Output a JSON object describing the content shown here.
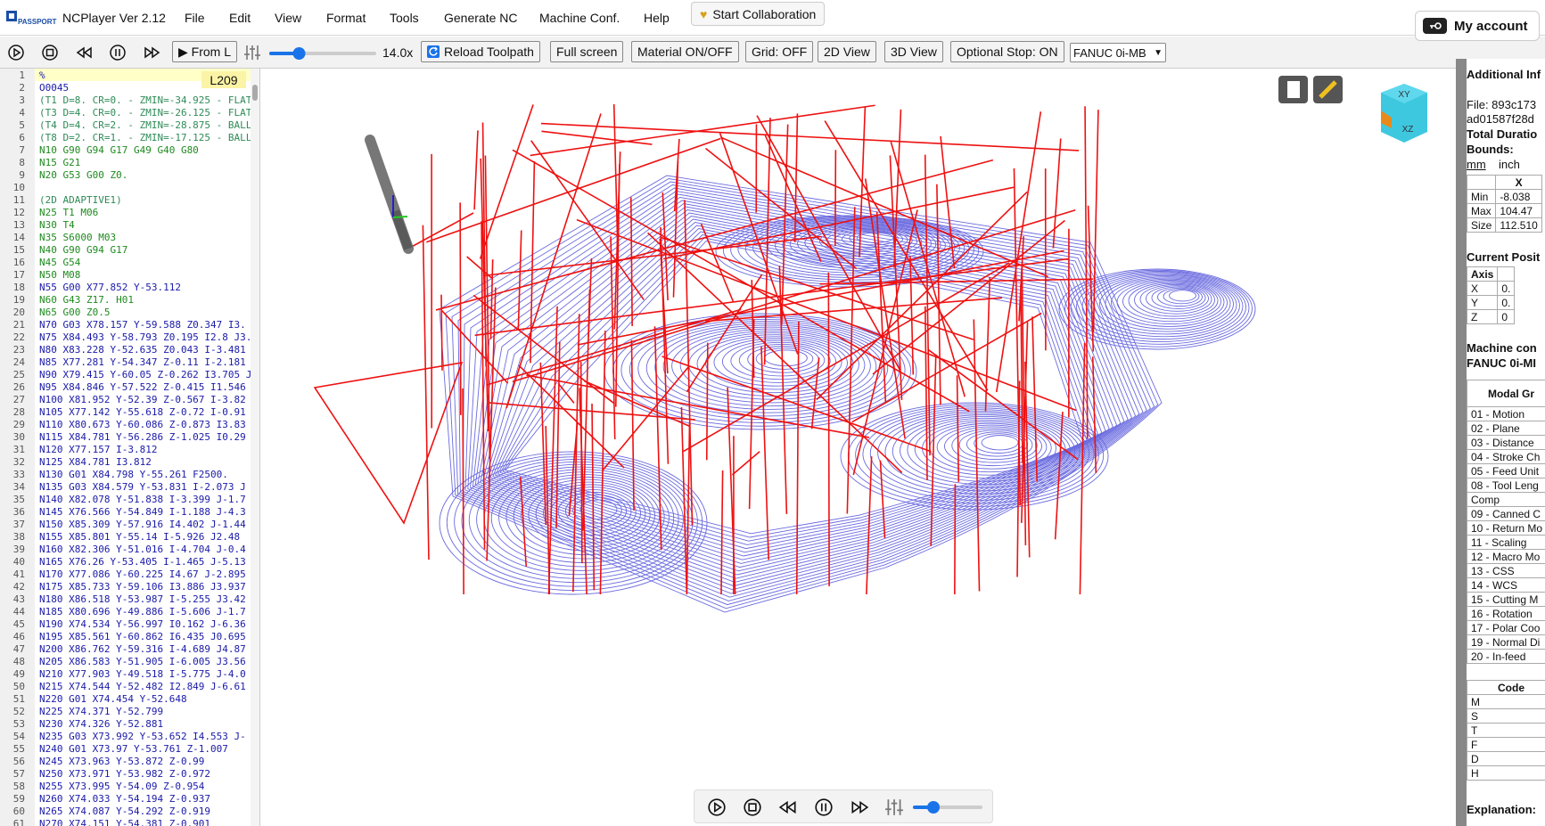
{
  "app": {
    "title": "NCPlayer Ver 2.12",
    "logo_text": "PASSPORT"
  },
  "menu": [
    "File",
    "Edit",
    "View",
    "Format",
    "Tools",
    "Generate NC",
    "Machine Conf.",
    "Help"
  ],
  "collaboration_button": "Start Collaboration",
  "account_button": "My account",
  "toolbar": {
    "from_line": "▶ From L",
    "speed_value": 0.25,
    "speed_label": "14.0x",
    "reload": "Reload Toolpath",
    "full_screen": "Full screen",
    "material": "Material ON/OFF",
    "grid": "Grid: OFF",
    "view2d": "2D View",
    "view3d": "3D View",
    "optional_stop": "Optional Stop: ON",
    "control": "FANUC 0i-MB"
  },
  "editor": {
    "line_badge": "L209",
    "lines": [
      "%",
      "O0045",
      "(T1 D=8. CR=0. - ZMIN=-34.925 - FLAT",
      "(T3 D=4. CR=0. - ZMIN=-26.125 - FLAT",
      "(T4 D=4. CR=2. - ZMIN=-28.875 - BALL",
      "(T8 D=2. CR=1. - ZMIN=-17.125 - BALL",
      "N10 G90 G94 G17 G49 G40 G80",
      "N15 G21",
      "N20 G53 G00 Z0.",
      "",
      "(2D ADAPTIVE1)",
      "N25 T1 M06",
      "N30 T4",
      "N35 S6000 M03",
      "N40 G90 G94 G17",
      "N45 G54",
      "N50 M08",
      "N55 G00 X77.852 Y-53.112",
      "N60 G43 Z17. H01",
      "N65 G00 Z0.5",
      "N70 G03 X78.157 Y-59.588 Z0.347 I3.",
      "N75 X84.493 Y-58.793 Z0.195 I2.8 J3.",
      "N80 X83.228 Y-52.635 Z0.043 I-3.481",
      "N85 X77.281 Y-54.347 Z-0.11 I-2.181",
      "N90 X79.415 Y-60.05 Z-0.262 I3.705 J",
      "N95 X84.846 Y-57.522 Z-0.415 I1.546",
      "N100 X81.952 Y-52.39 Z-0.567 I-3.82",
      "N105 X77.142 Y-55.618 Z-0.72 I-0.91",
      "N110 X80.673 Y-60.086 Z-0.873 I3.83",
      "N115 X84.781 Y-56.286 Z-1.025 I0.29",
      "N120 X77.157 I-3.812",
      "N125 X84.781 I3.812",
      "N130 G01 X84.798 Y-55.261 F2500.",
      "N135 G03 X84.579 Y-53.831 I-2.073 J",
      "N140 X82.078 Y-51.838 I-3.399 J-1.7",
      "N145 X76.566 Y-54.849 I-1.188 J-4.3",
      "N150 X85.309 Y-57.916 I4.402 J-1.44",
      "N155 X85.801 Y-55.14 I-5.926 J2.48",
      "N160 X82.306 Y-51.016 I-4.704 J-0.4",
      "N165 X76.26 Y-53.405 I-1.465 J-5.13",
      "N170 X77.086 Y-60.225 I4.67 J-2.895",
      "N175 X85.733 Y-59.106 I3.886 J3.937",
      "N180 X86.518 Y-53.987 I-5.255 J3.42",
      "N185 X80.696 Y-49.886 I-5.606 J-1.7",
      "N190 X74.534 Y-56.997 I0.162 J-6.36",
      "N195 X85.561 Y-60.862 I6.435 J0.695",
      "N200 X86.762 Y-59.316 I-4.689 J4.87",
      "N205 X86.583 Y-51.905 I-6.005 J3.56",
      "N210 X77.903 Y-49.518 I-5.775 J-4.0",
      "N215 X74.544 Y-52.482 I2.849 J-6.61",
      "N220 G01 X74.454 Y-52.648",
      "N225 X74.371 Y-52.799",
      "N230 X74.326 Y-52.881",
      "N235 G03 X73.992 Y-53.652 I4.553 J-",
      "N240 G01 X73.97 Y-53.761 Z-1.007",
      "N245 X73.963 Y-53.872 Z-0.99",
      "N250 X73.971 Y-53.982 Z-0.972",
      "N255 X73.995 Y-54.09 Z-0.954",
      "N260 X74.033 Y-54.194 Z-0.937",
      "N265 X74.087 Y-54.292 Z-0.919",
      "N270 X74.151 Y-54.381 Z-0.901"
    ]
  },
  "panel": {
    "title": "Additional Inf",
    "file_label": "File: 893c173",
    "file_line2": "ad01587f28d",
    "total_duration": "Total Duratio",
    "bounds": "Bounds:",
    "unit_mm": "mm",
    "unit_inch": "inch",
    "bounds_header": "X",
    "bounds_rows": [
      [
        "Min",
        "-8.038"
      ],
      [
        "Max",
        "104.47"
      ],
      [
        "Size",
        "112.510"
      ]
    ],
    "current_position": "Current Posit",
    "axis_header": "Axis",
    "axis_rows": [
      [
        "X",
        "0."
      ],
      [
        "Y",
        "0."
      ],
      [
        "Z",
        "0"
      ]
    ],
    "machine_conf": "Machine con",
    "machine_name": "FANUC 0i-MI",
    "modal_header": "Modal Gr",
    "modal_rows": [
      "01 - Motion",
      "02 - Plane",
      "03 - Distance",
      "04 - Stroke Ch",
      "05 - Feed Unit",
      "08 - Tool Leng",
      "Comp",
      "09 - Canned C",
      "10 - Return Mo",
      "11 - Scaling",
      "12 - Macro Mo",
      "13 - CSS",
      "14 - WCS",
      "15 - Cutting M",
      "16 - Rotation",
      "17 - Polar Coo",
      "19 - Normal Di",
      "20 - In-feed"
    ],
    "code_header": "Code",
    "code_rows": [
      "M",
      "S",
      "T",
      "F",
      "D",
      "H"
    ],
    "explanation": "Explanation:"
  },
  "colors": {
    "toolpath_feed": "#6a6ae0",
    "toolpath_rapid": "#ee1111",
    "cube": "#3ec8e0"
  },
  "cube_labels": {
    "top": "XY",
    "front": "XZ"
  }
}
